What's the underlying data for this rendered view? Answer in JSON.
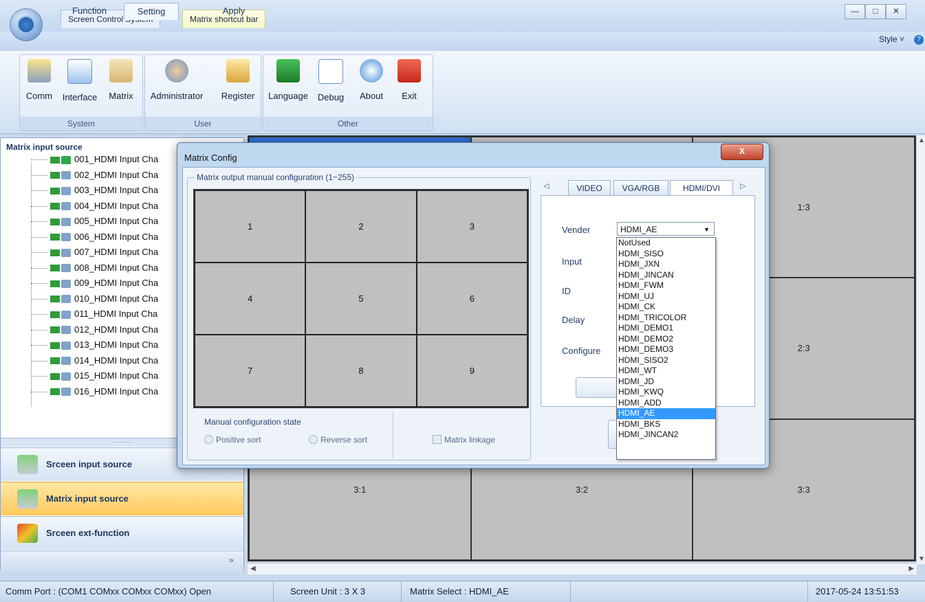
{
  "app": {
    "quick_tabs": [
      "Screen Control System",
      "Matrix shortcut bar"
    ],
    "window_controls": [
      "—",
      "□",
      "✕"
    ]
  },
  "ribbon": {
    "tabs": [
      "Function",
      "Setting",
      "Apply"
    ],
    "active_tab": "Setting",
    "style_menu": "Style ˅",
    "groups": [
      {
        "label": "System",
        "buttons": [
          "Comm",
          "Interface",
          "Matrix"
        ]
      },
      {
        "label": "User",
        "buttons": [
          "Administrator",
          "Register"
        ]
      },
      {
        "label": "Other",
        "buttons": [
          "Language",
          "Debug",
          "About",
          "Exit"
        ]
      }
    ]
  },
  "left_panel": {
    "title": "Matrix input source",
    "items": [
      "001_HDMI Input Cha",
      "002_HDMI Input Cha",
      "003_HDMI Input Cha",
      "004_HDMI Input Cha",
      "005_HDMI Input Cha",
      "006_HDMI Input Cha",
      "007_HDMI Input Cha",
      "008_HDMI Input Cha",
      "009_HDMI Input Cha",
      "010_HDMI Input Cha",
      "011_HDMI Input Cha",
      "012_HDMI Input Cha",
      "013_HDMI Input Cha",
      "014_HDMI Input Cha",
      "015_HDMI Input Cha",
      "016_HDMI Input Cha"
    ],
    "splitter_dots": "·········",
    "nav": [
      "Srceen input source",
      "Matrix input source",
      "Srceen ext-function"
    ],
    "nav_more": "»"
  },
  "screen_grid": {
    "cells": [
      "",
      "",
      "1:3",
      "",
      "",
      "2:3",
      "3:1",
      "3:2",
      "3:3"
    ]
  },
  "status": {
    "comm_port": "Comm Port : (COM1 COMxx COMxx COMxx)  Open",
    "screen_unit": "Screen Unit : 3 X 3",
    "matrix_select": "Matrix Select : HDMI_AE",
    "datetime": "2017-05-24 13:51:53"
  },
  "dialog": {
    "title": "Matrix Config",
    "close": "X",
    "fieldset_label": "Matrix output manual configuration (1~255)",
    "cells": [
      "1",
      "2",
      "3",
      "4",
      "5",
      "6",
      "7",
      "8",
      "9"
    ],
    "state_title": "Manual configuration state",
    "radio_positive": "Positive sort",
    "radio_reverse": "Reverse sort",
    "linkage": "Matrix linkage",
    "tabs": [
      "VIDEO",
      "VGA/RGB",
      "HDMI/DVI"
    ],
    "tab_left": "◁",
    "tab_right": "▷",
    "fields": {
      "vender": "Vender",
      "input": "Input",
      "id": "ID",
      "delay": "Delay",
      "configure": "Configure"
    },
    "vender_value": "HDMI_AE",
    "vender_options": [
      "NotUsed",
      "HDMI_SISO",
      "HDMI_JXN",
      "HDMI_JINCAN",
      "HDMI_FWM",
      "HDMI_UJ",
      "HDMI_CK",
      "HDMI_TRICOLOR",
      "HDMI_DEMO1",
      "HDMI_DEMO2",
      "HDMI_DEMO3",
      "HDMI_SISO2",
      "HDMI_WT",
      "HDMI_JD",
      "HDMI_KWQ",
      "HDMI_ADD",
      "HDMI_AE",
      "HDMI_BKS",
      "HDMI_JINCAN2"
    ],
    "selected_option": "HDMI_AE"
  },
  "colors": {
    "selection": "#3399ff",
    "grid_cell": "#c0c0c0",
    "nav_active": "#ffc95b"
  }
}
